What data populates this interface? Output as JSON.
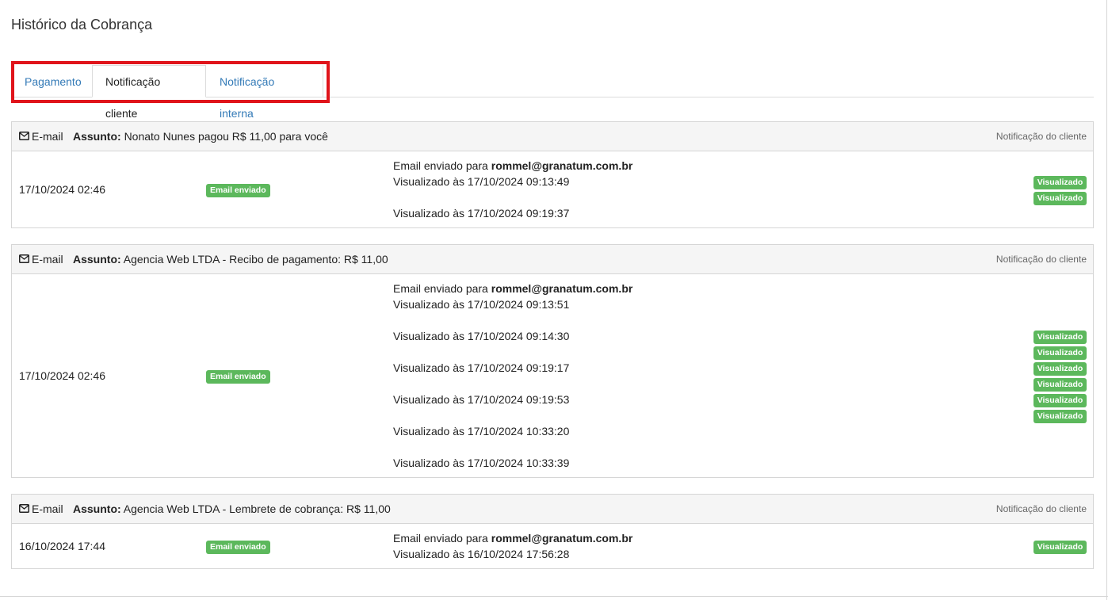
{
  "page": {
    "title": "Histórico da Cobrança"
  },
  "tabs": [
    {
      "label": "Pagamento",
      "active": false
    },
    {
      "label": "Notificação cliente",
      "active": true
    },
    {
      "label": "Notificação interna",
      "active": false
    }
  ],
  "colors": {
    "accent": "#337ab7",
    "badge": "#5cb85c",
    "highlight": "#e0141b"
  },
  "cards": [
    {
      "channel": "E-mail",
      "subject_label": "Assunto:",
      "subject": "Nonato Nunes pagou R$ 11,00 para você",
      "type": "Notificação do cliente",
      "date": "17/10/2024 02:46",
      "status": "Email enviado",
      "sent_prefix": "Email enviado para",
      "recipient": "rommel@granatum.com.br",
      "views": [
        "Visualizado às 17/10/2024 09:13:49",
        "Visualizado às 17/10/2024 09:19:37"
      ],
      "view_badges": [
        "Visualizado",
        "Visualizado"
      ]
    },
    {
      "channel": "E-mail",
      "subject_label": "Assunto:",
      "subject": "Agencia Web LTDA - Recibo de pagamento: R$ 11,00",
      "type": "Notificação do cliente",
      "date": "17/10/2024 02:46",
      "status": "Email enviado",
      "sent_prefix": "Email enviado para",
      "recipient": "rommel@granatum.com.br",
      "views": [
        "Visualizado às 17/10/2024 09:13:51",
        "Visualizado às 17/10/2024 09:14:30",
        "Visualizado às 17/10/2024 09:19:17",
        "Visualizado às 17/10/2024 09:19:53",
        "Visualizado às 17/10/2024 10:33:20",
        "Visualizado às 17/10/2024 10:33:39"
      ],
      "view_badges": [
        "Visualizado",
        "Visualizado",
        "Visualizado",
        "Visualizado",
        "Visualizado",
        "Visualizado"
      ]
    },
    {
      "channel": "E-mail",
      "subject_label": "Assunto:",
      "subject": "Agencia Web LTDA - Lembrete de cobrança: R$ 11,00",
      "type": "Notificação do cliente",
      "date": "16/10/2024 17:44",
      "status": "Email enviado",
      "sent_prefix": "Email enviado para",
      "recipient": "rommel@granatum.com.br",
      "views": [
        "Visualizado às 16/10/2024 17:56:28"
      ],
      "view_badges": [
        "Visualizado"
      ]
    }
  ]
}
